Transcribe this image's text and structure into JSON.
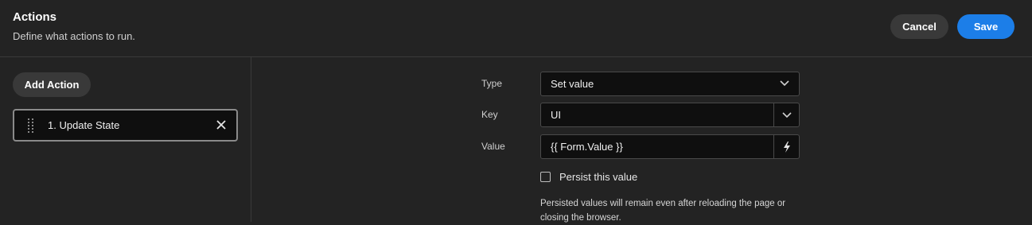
{
  "header": {
    "title": "Actions",
    "subtitle": "Define what actions to run.",
    "cancel_label": "Cancel",
    "save_label": "Save"
  },
  "left": {
    "add_action_label": "Add Action",
    "actions": [
      {
        "label": "1. Update State"
      }
    ]
  },
  "form": {
    "type": {
      "label": "Type",
      "value": "Set value"
    },
    "key": {
      "label": "Key",
      "value": "UI"
    },
    "value": {
      "label": "Value",
      "value": "{{ Form.Value }}"
    },
    "persist": {
      "label": "Persist this value",
      "checked": false
    },
    "help_text": "Persisted values will remain even after reloading the page or closing the browser."
  },
  "colors": {
    "background": "#232323",
    "accent": "#1c7ee8",
    "button_secondary": "#393939",
    "field_bg": "#0f0f0f"
  },
  "icons": [
    "drag-handle-icon",
    "close-icon",
    "chevron-down-icon",
    "lightning-bolt-icon"
  ]
}
